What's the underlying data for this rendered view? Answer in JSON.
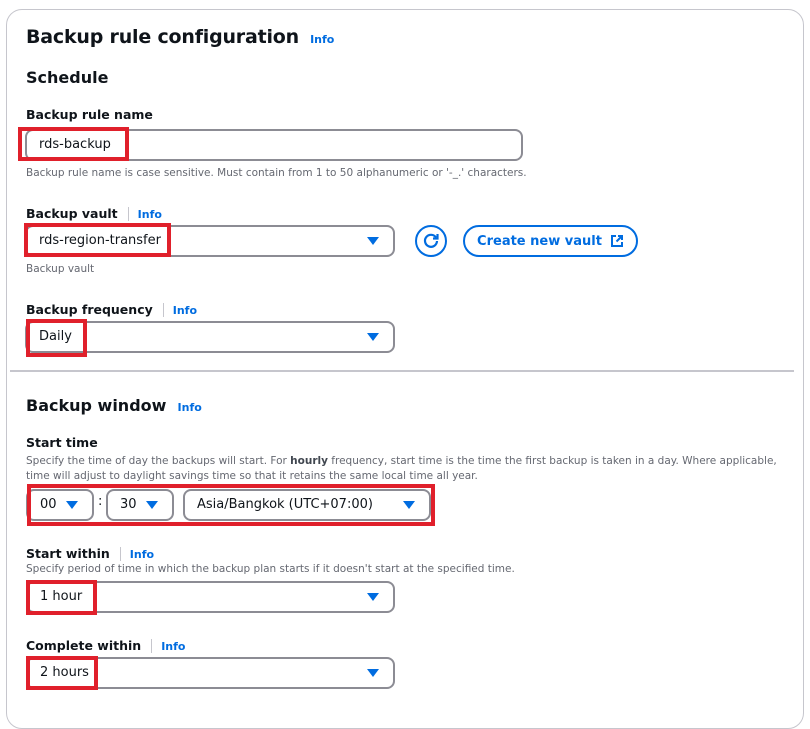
{
  "header": {
    "title": "Backup rule configuration",
    "info": "Info"
  },
  "schedule": {
    "title": "Schedule",
    "rule_name": {
      "label": "Backup rule name",
      "value": "rds-backup",
      "hint": "Backup rule name is case sensitive. Must contain from 1 to 50 alphanumeric or '-_.' characters."
    },
    "vault": {
      "label": "Backup vault",
      "info": "Info",
      "value": "rds-region-transfer",
      "hint": "Backup vault",
      "refresh_icon": "refresh-icon",
      "create_label": "Create new vault",
      "create_icon": "external-link-icon"
    },
    "frequency": {
      "label": "Backup frequency",
      "info": "Info",
      "value": "Daily"
    }
  },
  "window": {
    "title": "Backup window",
    "info": "Info",
    "start_time": {
      "label": "Start time",
      "desc_before": "Specify the time of day the backups will start. For ",
      "desc_bold": "hourly",
      "desc_after": " frequency, start time is the time the first backup is taken in a day. Where applicable, time will adjust to daylight savings time so that it retains the same local time all year.",
      "hour": "00",
      "separator": ":",
      "minute": "30",
      "timezone": "Asia/Bangkok (UTC+07:00)"
    },
    "start_within": {
      "label": "Start within",
      "info": "Info",
      "desc": "Specify period of time in which the backup plan starts if it doesn't start at the specified time.",
      "value": "1 hour"
    },
    "complete_within": {
      "label": "Complete within",
      "info": "Info",
      "value": "2 hours"
    }
  },
  "colors": {
    "accent": "#006ce0",
    "highlight": "#e0202b",
    "border": "#8c8c94"
  }
}
